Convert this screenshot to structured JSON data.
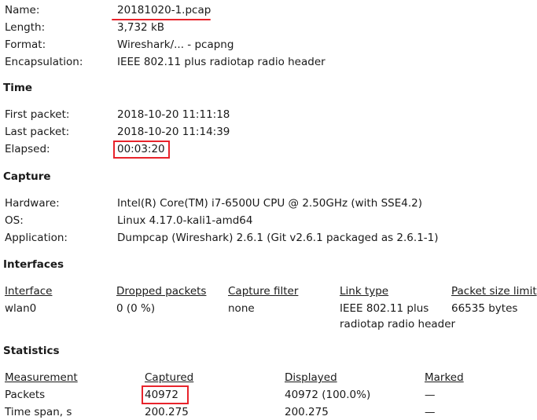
{
  "file": {
    "rows": [
      {
        "label": "Name:",
        "value": "20181020-1.pcap"
      },
      {
        "label": "Length:",
        "value": "3,732 kB"
      },
      {
        "label": "Format:",
        "value": "Wireshark/... - pcapng"
      },
      {
        "label": "Encapsulation:",
        "value": "IEEE 802.11 plus radiotap radio header"
      }
    ]
  },
  "time": {
    "title": "Time",
    "rows": [
      {
        "label": "First packet:",
        "value": "2018-10-20 11:11:18"
      },
      {
        "label": "Last packet:",
        "value": "2018-10-20 11:14:39"
      },
      {
        "label": "Elapsed:",
        "value": "00:03:20"
      }
    ]
  },
  "capture": {
    "title": "Capture",
    "rows": [
      {
        "label": "Hardware:",
        "value": "Intel(R) Core(TM) i7-6500U CPU @ 2.50GHz (with SSE4.2)"
      },
      {
        "label": "OS:",
        "value": "Linux 4.17.0-kali1-amd64"
      },
      {
        "label": "Application:",
        "value": "Dumpcap (Wireshark) 2.6.1 (Git v2.6.1 packaged as 2.6.1-1)"
      }
    ]
  },
  "interfaces": {
    "title": "Interfaces",
    "headers": [
      "Interface",
      "Dropped packets",
      "Capture filter",
      "Link type",
      "Packet size limit"
    ],
    "row": [
      "wlan0",
      "0 (0 %)",
      "none",
      "IEEE 802.11 plus",
      "66535 bytes"
    ],
    "link_type_cont": "radiotap radio header"
  },
  "statistics": {
    "title": "Statistics",
    "headers": [
      "Measurement",
      "Captured",
      "Displayed",
      "Marked"
    ],
    "rows": [
      [
        "Packets",
        "40972",
        "40972 (100.0%)",
        "—"
      ],
      [
        "Time span, s",
        "200.275",
        "200.275",
        "—"
      ]
    ]
  }
}
